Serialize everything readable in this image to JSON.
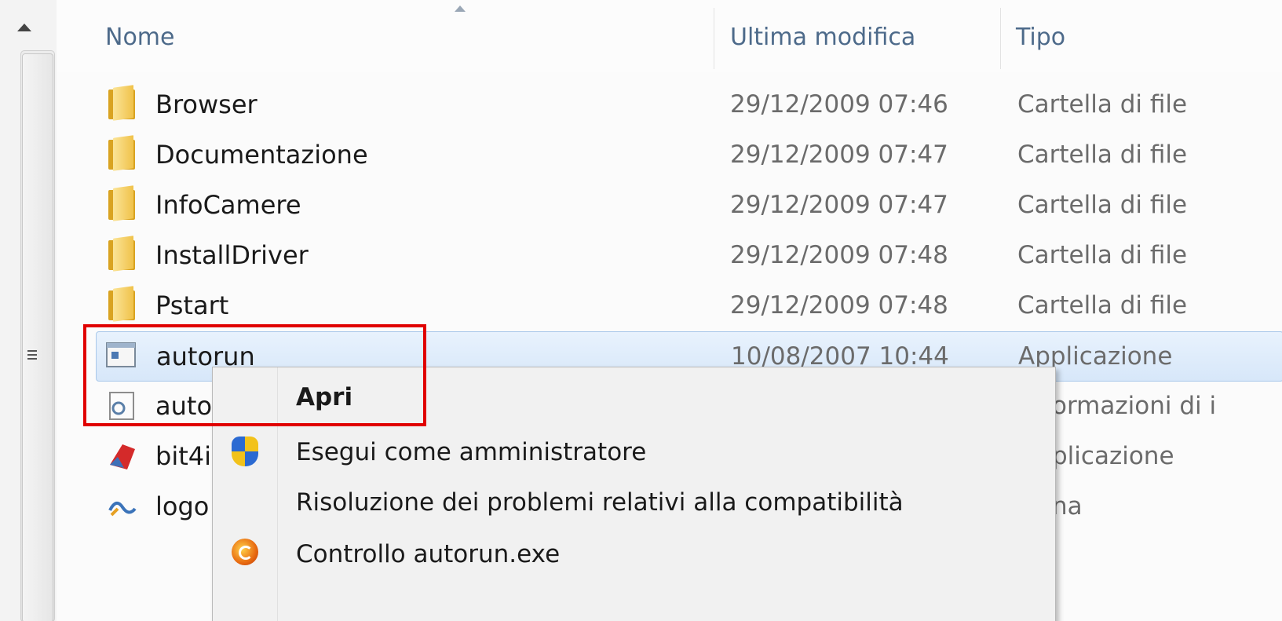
{
  "columns": {
    "name": "Nome",
    "modified": "Ultima modifica",
    "type": "Tipo"
  },
  "rows": [
    {
      "name": "Browser",
      "date": "29/12/2009 07:46",
      "type": "Cartella di file",
      "icon": "folder-icon"
    },
    {
      "name": "Documentazione",
      "date": "29/12/2009 07:47",
      "type": "Cartella di file",
      "icon": "folder-icon"
    },
    {
      "name": "InfoCamere",
      "date": "29/12/2009 07:47",
      "type": "Cartella di file",
      "icon": "folder-icon"
    },
    {
      "name": "InstallDriver",
      "date": "29/12/2009 07:48",
      "type": "Cartella di file",
      "icon": "folder-icon"
    },
    {
      "name": "Pstart",
      "date": "29/12/2009 07:48",
      "type": "Cartella di file",
      "icon": "folder-icon"
    },
    {
      "name": "autorun",
      "date": "10/08/2007 10:44",
      "type": "Applicazione",
      "icon": "application-icon",
      "selected": true
    },
    {
      "name": "auto",
      "type_visible": "ormazioni di i",
      "icon": "settings-file-icon"
    },
    {
      "name": "bit4i",
      "type_visible": "plicazione",
      "icon": "bit4id-app-icon"
    },
    {
      "name": "logo",
      "type_visible": "na",
      "icon": "image-file-icon"
    }
  ],
  "context_menu": {
    "items": [
      {
        "label": "Apri",
        "bold": true
      },
      {
        "label": "Esegui come amministratore",
        "icon": "uac-shield-icon"
      },
      {
        "label": "Risoluzione dei problemi relativi alla compatibilità"
      },
      {
        "label": "Controllo autorun.exe",
        "icon": "antivirus-icon"
      }
    ]
  },
  "colors": {
    "header_text": "#4d6a8a",
    "secondary_text": "#6b6b6b",
    "selection_bg": "#d7e7f9",
    "highlight_box": "#e00000"
  }
}
